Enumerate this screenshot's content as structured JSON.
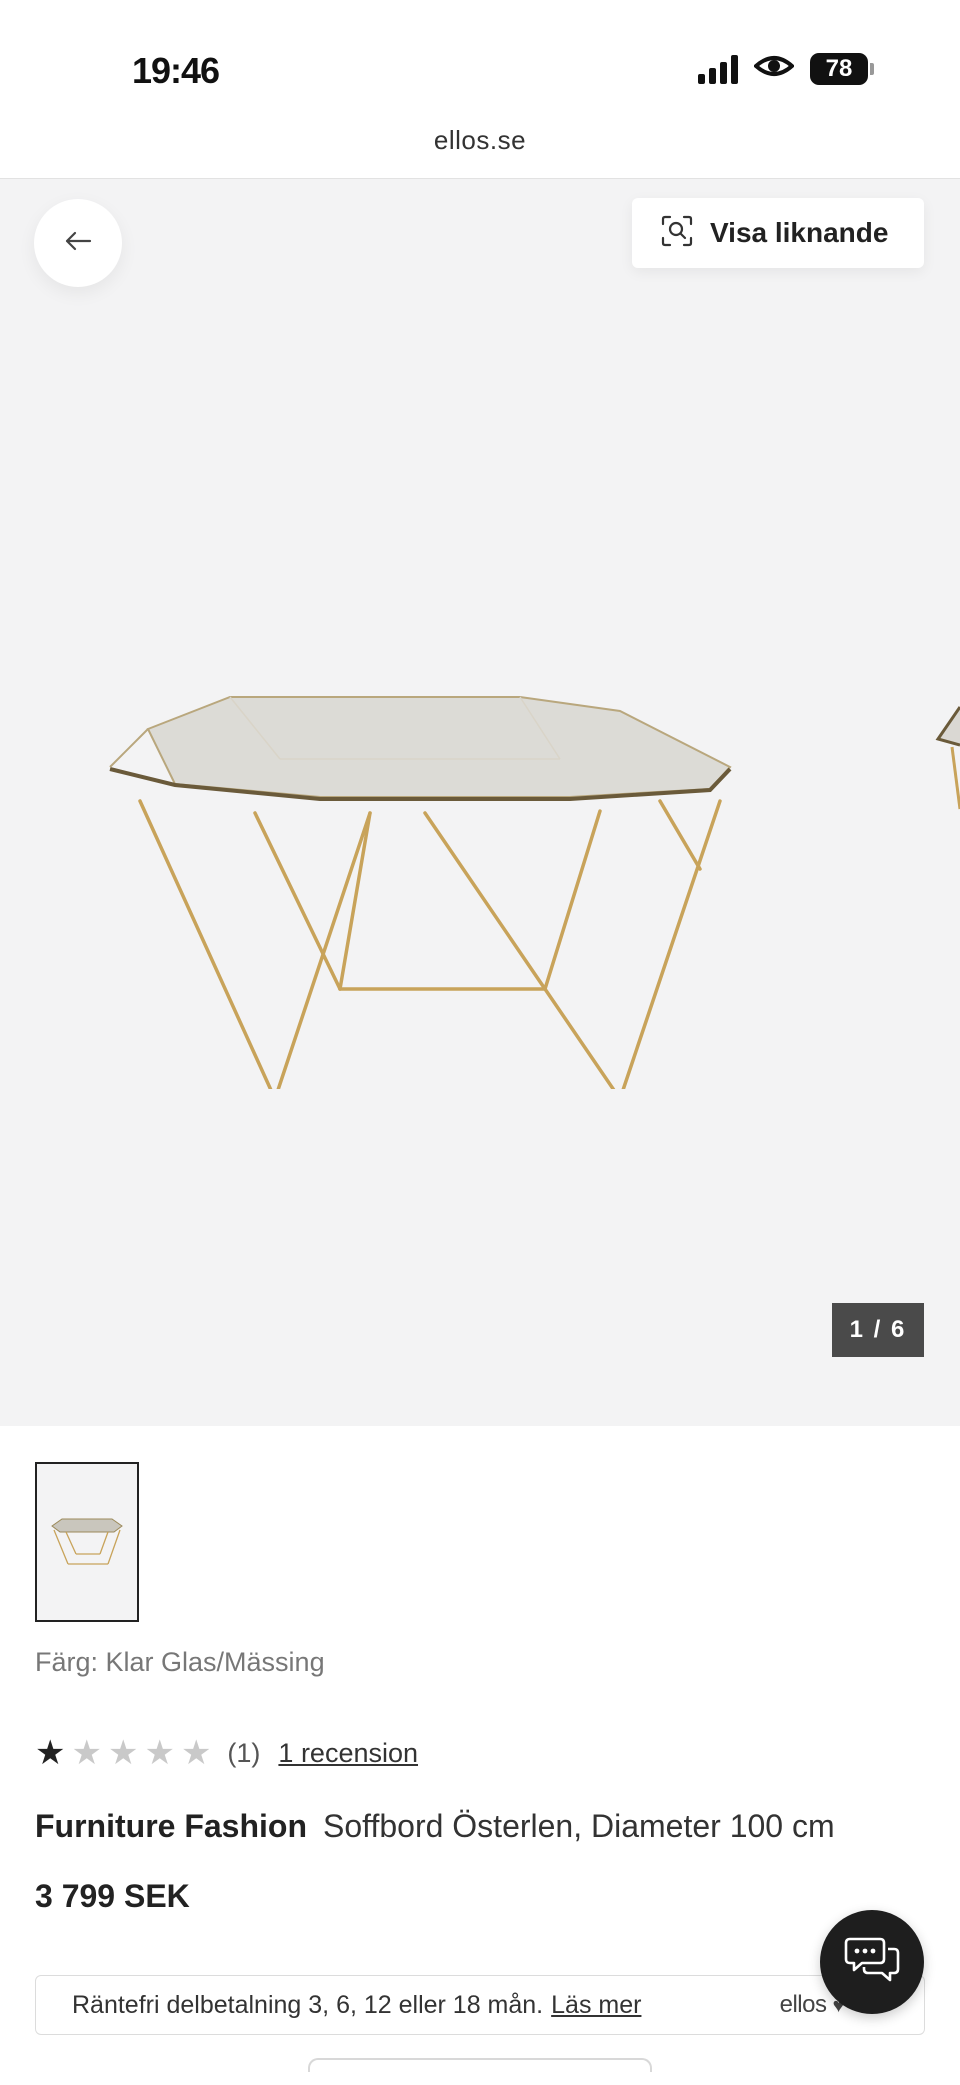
{
  "status_bar": {
    "time": "19:46",
    "battery": "78"
  },
  "browser": {
    "url": "ellos.se"
  },
  "gallery": {
    "similar_label": "Visa liknande",
    "counter": "1 / 6"
  },
  "product": {
    "color_text": "Färg: Klar Glas/Mässing",
    "rating": {
      "value": 1,
      "max": 5,
      "count_text": "(1)",
      "review_link": "1 recension"
    },
    "brand": "Furniture Fashion",
    "name": "Soffbord Österlen, Diameter 100 cm",
    "price": "3 799 SEK"
  },
  "finance": {
    "text": "Räntefri delbetalning 3, 6, 12 eller 18 mån.",
    "link": "Läs mer",
    "brand": "ellos"
  },
  "icons": {
    "back": "arrow-left-icon",
    "similar": "visual-search-icon",
    "chat": "chat-bubbles-icon",
    "heart": "heart-icon"
  }
}
